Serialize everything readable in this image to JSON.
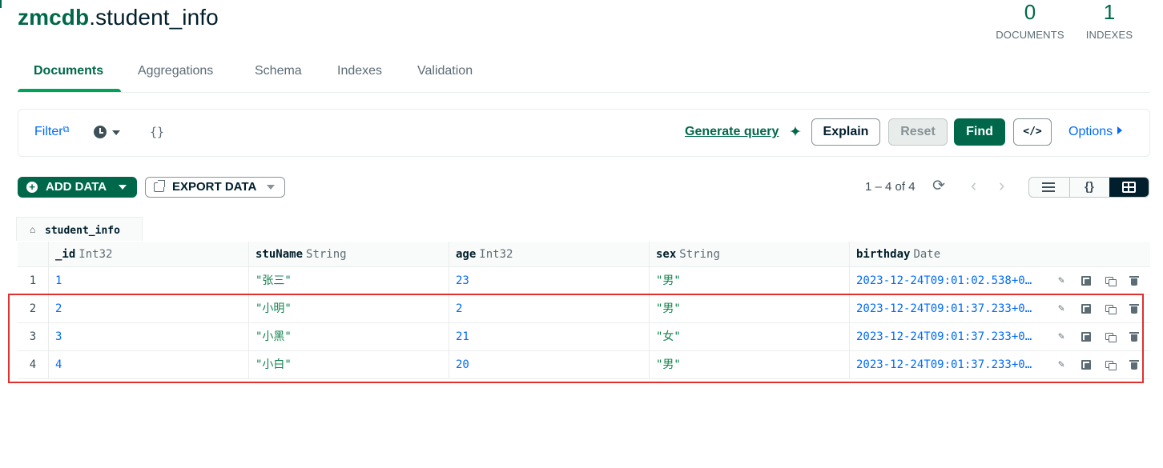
{
  "namespace": {
    "db": "zmcdb",
    "collection": ".student_info"
  },
  "stats": [
    {
      "value": "0",
      "label": "DOCUMENTS"
    },
    {
      "value": "1",
      "label": "INDEXES"
    }
  ],
  "tabs": [
    "Documents",
    "Aggregations",
    "Schema",
    "Indexes",
    "Validation"
  ],
  "query_bar": {
    "filter_label": "Filter",
    "filter_value": "{}",
    "generate_query": "Generate query",
    "explain": "Explain",
    "reset": "Reset",
    "find": "Find",
    "code_toggle": "</>",
    "options": "Options"
  },
  "toolbar": {
    "add_data": "ADD DATA",
    "export_data": "EXPORT DATA",
    "pagination": "1 – 4 of 4"
  },
  "breadcrumb": {
    "label": "student_info"
  },
  "table": {
    "columns": [
      {
        "name": "_id",
        "type": "Int32"
      },
      {
        "name": "stuName",
        "type": "String"
      },
      {
        "name": "age",
        "type": "Int32"
      },
      {
        "name": "sex",
        "type": "String"
      },
      {
        "name": "birthday",
        "type": "Date"
      }
    ],
    "rows": [
      {
        "num": "1",
        "_id": "1",
        "stuName": "\"张三\"",
        "age": "23",
        "sex": "\"男\"",
        "birthday": "2023-12-24T09:01:02.538+0…"
      },
      {
        "num": "2",
        "_id": "2",
        "stuName": "\"小明\"",
        "age": "2",
        "sex": "\"男\"",
        "birthday": "2023-12-24T09:01:37.233+0…"
      },
      {
        "num": "3",
        "_id": "3",
        "stuName": "\"小黑\"",
        "age": "21",
        "sex": "\"女\"",
        "birthday": "2023-12-24T09:01:37.233+0…"
      },
      {
        "num": "4",
        "_id": "4",
        "stuName": "\"小白\"",
        "age": "20",
        "sex": "\"男\"",
        "birthday": "2023-12-24T09:01:37.233+0…"
      }
    ]
  },
  "colors": {
    "brand_green": "#00684a",
    "link_blue": "#016bf8",
    "string_green": "#12824d",
    "highlight_red": "#e0312f"
  },
  "icons": [
    "external-link-icon",
    "clock-icon",
    "sparkle-icon",
    "plus-circle-icon",
    "export-icon",
    "refresh-icon",
    "chevron-left-icon",
    "chevron-right-icon",
    "list-view-icon",
    "json-view-icon",
    "table-view-icon",
    "home-icon",
    "edit-icon",
    "copy-icon",
    "clone-icon",
    "trash-icon"
  ]
}
